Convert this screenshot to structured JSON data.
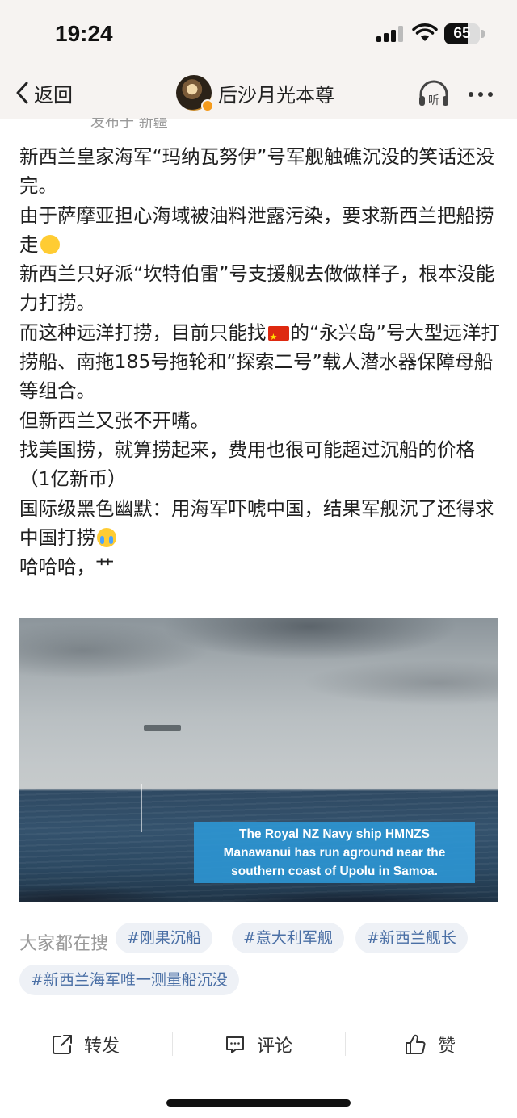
{
  "status_bar": {
    "time": "19:24",
    "battery_level": "65",
    "battery_fraction": 0.65
  },
  "nav": {
    "back_label": "返回",
    "author_name": "后沙月光本尊",
    "listen_icon_text": "听"
  },
  "post": {
    "clipped_header_text": "发布于 新疆",
    "paragraphs": [
      "新西兰皇家海军“玛纳瓦努伊”号军舰触礁沉没的笑话还没完。",
      "由于萨摩亚担心海域被油料泄露污染，要求新西兰把船捞走",
      "新西兰只好派“坎特伯雷”号支援舰去做做样子，根本没能力打捞。",
      "而这种远洋打捞，目前只能找",
      "的“永兴岛”号大型远洋打捞船、南拖185号拖轮和“探索二号”载人潜水器保障母船等组合。",
      "但新西兰又张不开嘴。",
      "找美国捞，就算捞起来，费用也很可能超过沉船的价格（1亿新币）",
      "国际级黑色幽默：用海军吓唬中国，结果军舰沉了还得求中国打捞",
      "哈哈哈，艹"
    ],
    "image_caption": [
      "The Royal NZ Navy ship HMNZS",
      "Manawanui has run aground near the",
      "southern coast of Upolu in Samoa."
    ]
  },
  "search": {
    "label": "大家都在搜",
    "tags": [
      "#刚果沉船",
      "#意大利军舰",
      "#新西兰舰长",
      "#新西兰海军唯一测量船沉没"
    ]
  },
  "actions": {
    "repost": "转发",
    "comment": "评论",
    "like": "赞"
  }
}
